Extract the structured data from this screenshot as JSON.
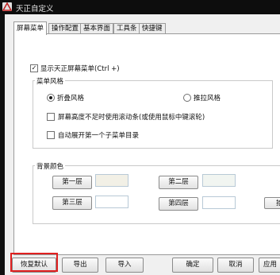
{
  "window": {
    "title": "天正自定义"
  },
  "tabs": [
    {
      "label": "屏幕菜单"
    },
    {
      "label": "操作配置"
    },
    {
      "label": "基本界面"
    },
    {
      "label": "工具条"
    },
    {
      "label": "快捷键"
    }
  ],
  "screen_menu": {
    "show_menu_label": "显示天正屏幕菜单(Ctrl +)",
    "show_menu_checked": true,
    "style_group_title": "菜单风格",
    "style_options": [
      {
        "label": "折叠风格",
        "selected": true
      },
      {
        "label": "推拉风格",
        "selected": false
      }
    ],
    "scrollbar_label": "屏幕高度不足时使用滚动条(或使用鼠标中键滚轮)",
    "scrollbar_checked": false,
    "auto_expand_label": "自动展开第一个子菜单目录",
    "auto_expand_checked": false
  },
  "background": {
    "group_title": "背景颜色",
    "levels": [
      {
        "label": "第一层",
        "color": "#f2f0e6"
      },
      {
        "label": "第二层",
        "color": "#f1f5f1"
      },
      {
        "label": "第三层",
        "color": "#ffffff"
      },
      {
        "label": "第四层",
        "color": "#ffffff"
      }
    ],
    "partial_button_label": "拾"
  },
  "footer": {
    "reset_label": "恢复默认",
    "export_label": "导出",
    "import_label": "导入",
    "ok_label": "确定",
    "cancel_label": "取消",
    "apply_label": "应用"
  },
  "colors": {
    "highlight": "#e02020",
    "titlebar": "#0d0d0d"
  }
}
